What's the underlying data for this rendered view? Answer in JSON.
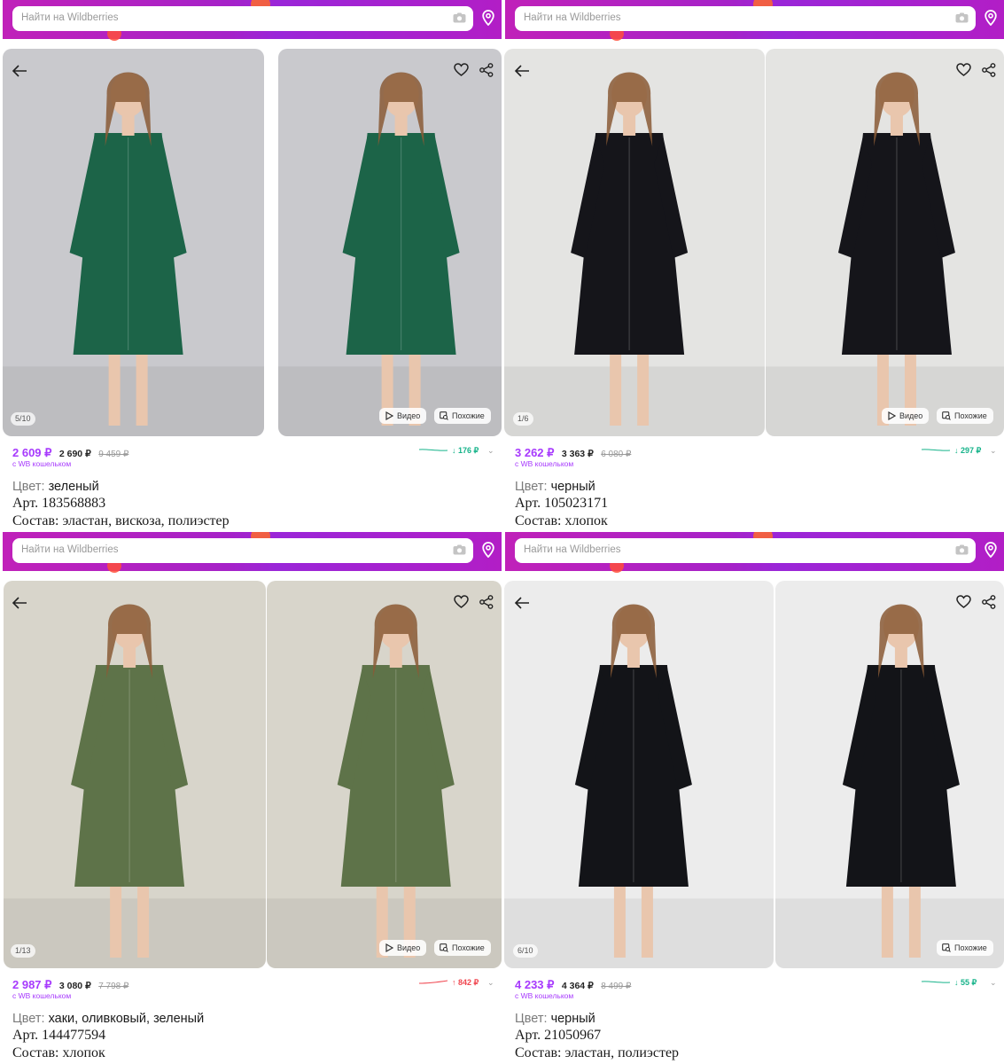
{
  "search": {
    "placeholder": "Найти на Wildberries"
  },
  "ui": {
    "video_label": "Видео",
    "similar_label": "Похожие",
    "wallet_label": "с WB кошельком",
    "color_label": "Цвет:"
  },
  "products": [
    {
      "counter": "5/10",
      "price": "2 609 ₽",
      "price_secondary": "2 690 ₽",
      "price_old": "9 459 ₽",
      "trend": "↓ 176 ₽",
      "trend_direction": "down",
      "color": "зеленый",
      "article": "Арт. 183568883",
      "composition": "Состав: эластан, вискоза, полиэстер",
      "has_video": true,
      "dress_color": "#1c6448",
      "bg_color": "#c9c9cd"
    },
    {
      "counter": "1/6",
      "price": "3 262 ₽",
      "price_secondary": "3 363 ₽",
      "price_old": "6 080 ₽",
      "trend": "↓ 297 ₽",
      "trend_direction": "down",
      "color": "черный",
      "article": "Арт. 105023171",
      "composition": "Состав: хлопок",
      "has_video": true,
      "dress_color": "#15151a",
      "bg_color": "#e4e4e2"
    },
    {
      "counter": "1/13",
      "price": "2 987 ₽",
      "price_secondary": "3 080 ₽",
      "price_old": "7 798 ₽",
      "trend": "↑ 842 ₽",
      "trend_direction": "up",
      "color": "хаки, оливковый, зеленый",
      "article": "Арт. 144477594",
      "composition": "Состав: хлопок",
      "has_video": true,
      "dress_color": "#5e7349",
      "bg_color": "#d8d5cb"
    },
    {
      "counter": "6/10",
      "price": "4 233 ₽",
      "price_secondary": "4 364 ₽",
      "price_old": "8 499 ₽",
      "trend": "↓ 55 ₽",
      "trend_direction": "down",
      "color": "черный",
      "article": "Арт. 21050967",
      "composition": "Состав: эластан, полиэстер",
      "has_video": false,
      "dress_color": "#131418",
      "bg_color": "#ececec"
    }
  ]
}
